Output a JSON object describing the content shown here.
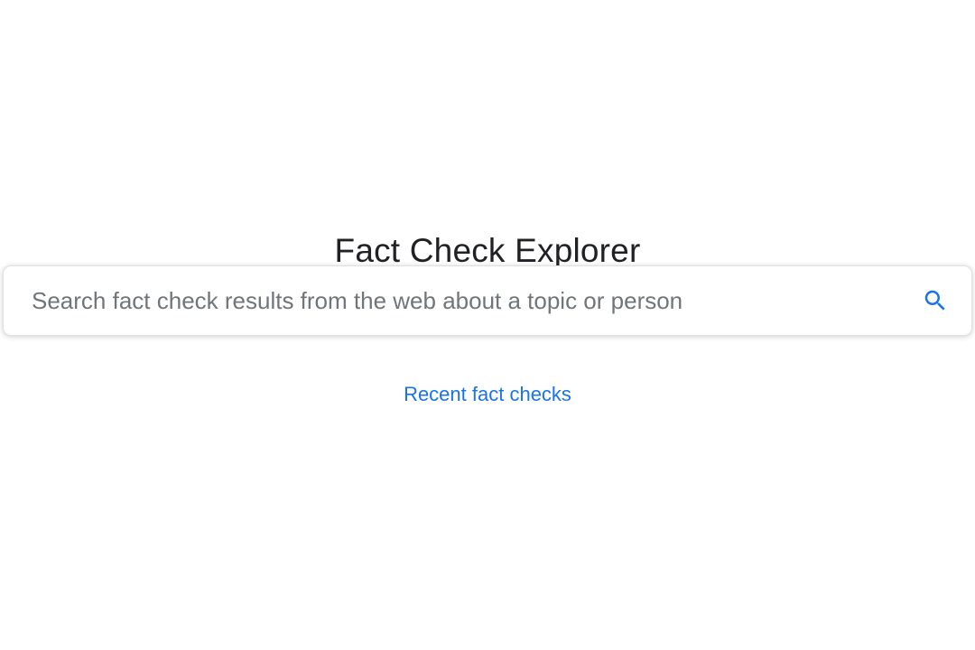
{
  "header": {
    "title": "Fact Check Explorer"
  },
  "search": {
    "placeholder": "Search fact check results from the web about a topic or person",
    "value": "",
    "icon": "search-icon",
    "icon_color": "#1a73e8"
  },
  "links": {
    "recent_label": "Recent fact checks",
    "link_color": "#1a73e8"
  }
}
